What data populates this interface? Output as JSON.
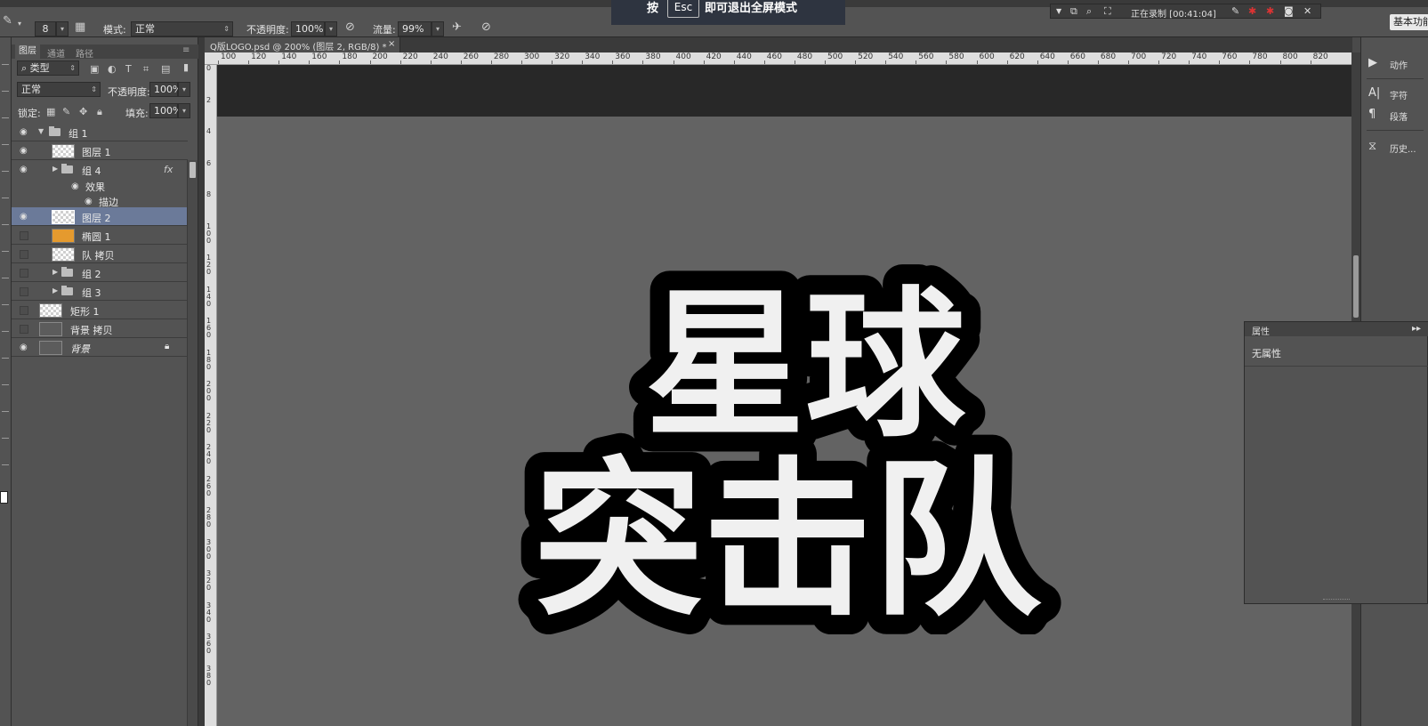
{
  "options_bar": {
    "brush_size": "8",
    "mode_label": "模式:",
    "mode_value": "正常",
    "opacity_label": "不透明度:",
    "opacity_value": "100%",
    "flow_label": "流量:",
    "flow_value": "99%"
  },
  "esc_banner": {
    "prefix": "按",
    "key": "Esc",
    "suffix": "即可退出全屏模式"
  },
  "recording": {
    "status": "正在录制 [00:41:04]"
  },
  "workspace_button": "基本功能",
  "layers_panel": {
    "tabs": [
      "图层",
      "通道",
      "路径"
    ],
    "filter_label": "类型",
    "blend_mode": "正常",
    "opacity_label": "不透明度:",
    "opacity_value": "100%",
    "lock_label": "锁定:",
    "fill_label": "填充:",
    "fill_value": "100%",
    "layers": [
      {
        "name": "组 1",
        "type": "group",
        "visible": true,
        "expanded": true
      },
      {
        "name": "图层 1",
        "type": "layer",
        "visible": true
      },
      {
        "name": "组 4",
        "type": "group",
        "visible": true,
        "fx": "fx"
      },
      {
        "name": "效果",
        "type": "effect",
        "visible": true
      },
      {
        "name": "描边",
        "type": "effect",
        "visible": true
      },
      {
        "name": "图层 2",
        "type": "layer",
        "visible": true,
        "selected": true
      },
      {
        "name": "椭圆 1",
        "type": "shape",
        "visible": false
      },
      {
        "name": "队 拷贝",
        "type": "layer",
        "visible": false
      },
      {
        "name": "组 2",
        "type": "group",
        "visible": false
      },
      {
        "name": "组 3",
        "type": "group",
        "visible": false
      },
      {
        "name": "矩形 1",
        "type": "shape",
        "visible": false
      },
      {
        "name": "背景 拷贝",
        "type": "layer",
        "visible": false
      },
      {
        "name": "背景",
        "type": "background",
        "visible": true,
        "locked": true
      }
    ]
  },
  "document": {
    "tab_title": "Q版LOGO.psd @ 200% (图层 2, RGB/8) *",
    "ruler_h": [
      "100",
      "120",
      "140",
      "160",
      "180",
      "200",
      "220",
      "240",
      "260",
      "280",
      "300",
      "320",
      "340",
      "360",
      "380",
      "400",
      "420",
      "440",
      "460",
      "480",
      "500",
      "520",
      "540",
      "560",
      "580",
      "600",
      "620",
      "640",
      "660",
      "680",
      "700",
      "720",
      "740",
      "760",
      "780",
      "800",
      "820"
    ],
    "ruler_v": [
      "0",
      "2",
      "4",
      "6",
      "8",
      "100",
      "120",
      "140",
      "160",
      "180",
      "200",
      "220",
      "240",
      "260",
      "280",
      "300",
      "320",
      "340",
      "360",
      "380"
    ],
    "logo_line1": "星球",
    "logo_line2": "突击队"
  },
  "right_panel": {
    "items": [
      {
        "icon": "play-icon",
        "label": "动作"
      },
      {
        "icon": "character-icon",
        "label": "字符"
      },
      {
        "icon": "paragraph-icon",
        "label": "段落"
      },
      {
        "icon": "history-icon",
        "label": "历史..."
      }
    ]
  },
  "properties_panel": {
    "title": "属性",
    "content": "无属性"
  },
  "colors": {
    "canvas": "#636363",
    "selection": "#6b7a99",
    "panel": "#535353"
  }
}
